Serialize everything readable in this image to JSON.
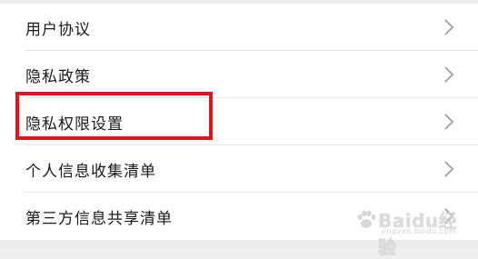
{
  "menu": {
    "items": [
      {
        "label": "用户协议"
      },
      {
        "label": "隐私政策"
      },
      {
        "label": "隐私权限设置"
      },
      {
        "label": "个人信息收集清单"
      },
      {
        "label": "第三方信息共享清单"
      }
    ]
  },
  "highlight": {
    "color": "#e0141e",
    "target": "隐私权限设置"
  },
  "watermark": {
    "brand": "Baidu经验",
    "subtitle": "jingyan.baidu.com"
  },
  "icons": {
    "row_arrow": "chevron-right-icon",
    "watermark_logo": "paw-icon"
  }
}
